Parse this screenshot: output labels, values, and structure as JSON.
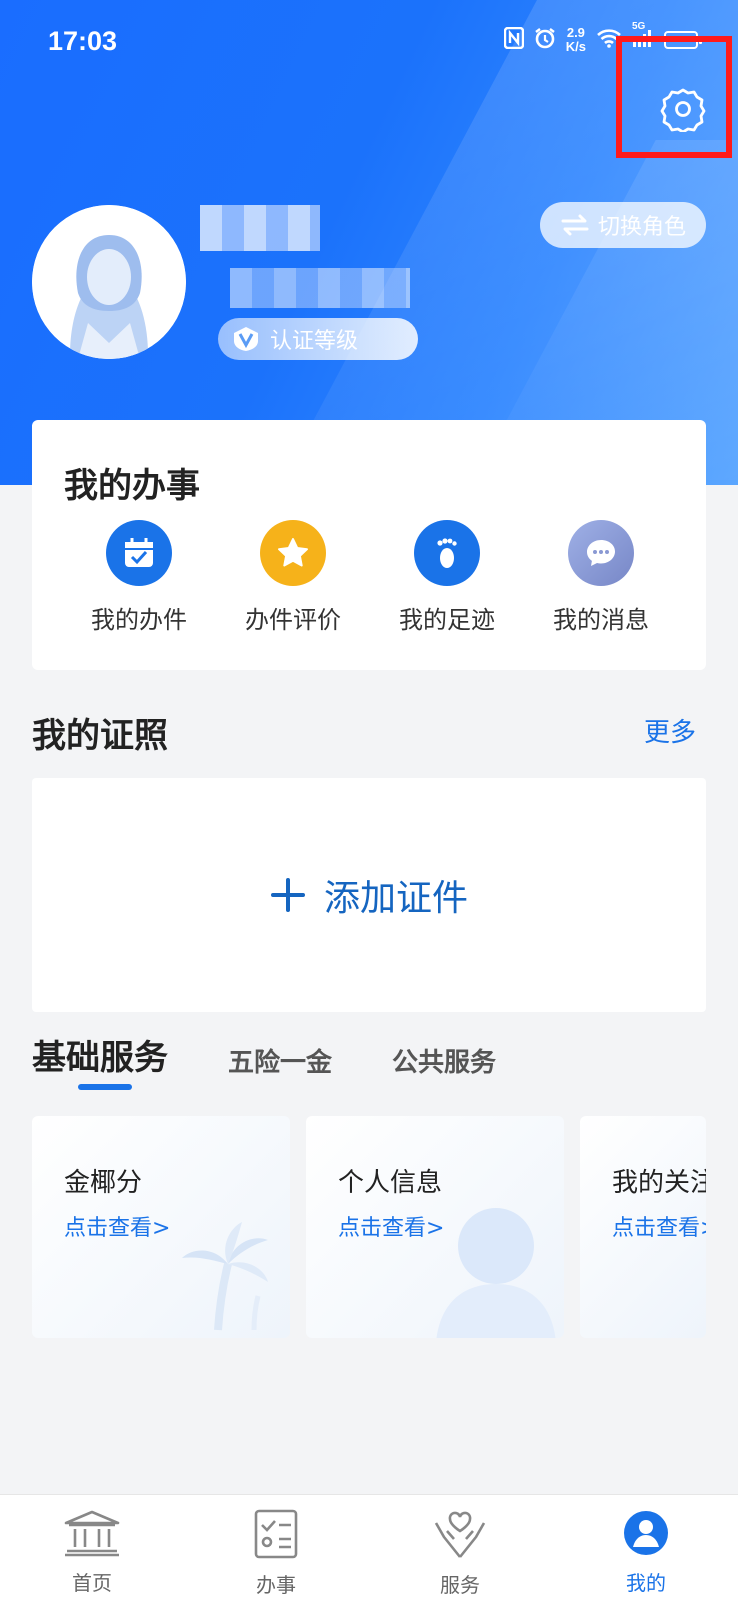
{
  "status_bar": {
    "time": "17:03",
    "speed_top": "2.9",
    "speed_bottom": "K/s",
    "network": "5G"
  },
  "header": {
    "switch_role_label": "切换角色",
    "auth_level_label": "认证等级"
  },
  "my_affairs": {
    "title": "我的办事",
    "items": [
      {
        "label": "我的办件",
        "icon": "calendar-check-icon",
        "color": "#1a73e8"
      },
      {
        "label": "办件评价",
        "icon": "star-icon",
        "color": "#f6b21a"
      },
      {
        "label": "我的足迹",
        "icon": "footprint-icon",
        "color": "#1a73e8"
      },
      {
        "label": "我的消息",
        "icon": "chat-bubble-icon",
        "color": "#8b9ad6"
      }
    ]
  },
  "certificates": {
    "title": "我的证照",
    "more_label": "更多",
    "add_label": "添加证件"
  },
  "services": {
    "tabs": [
      "基础服务",
      "五险一金",
      "公共服务"
    ],
    "cards": [
      {
        "name": "金椰分",
        "link": "点击查看>"
      },
      {
        "name": "个人信息",
        "link": "点击查看>"
      },
      {
        "name": "我的关注",
        "link": "点击查看>"
      }
    ]
  },
  "bottom_nav": [
    {
      "label": "首页",
      "icon": "bank-icon"
    },
    {
      "label": "办事",
      "icon": "document-icon"
    },
    {
      "label": "服务",
      "icon": "hands-heart-icon"
    },
    {
      "label": "我的",
      "icon": "user-icon"
    }
  ],
  "colors": {
    "primary": "#1a6dff",
    "accent": "#1a73e8",
    "highlight": "#ff1a1a"
  }
}
